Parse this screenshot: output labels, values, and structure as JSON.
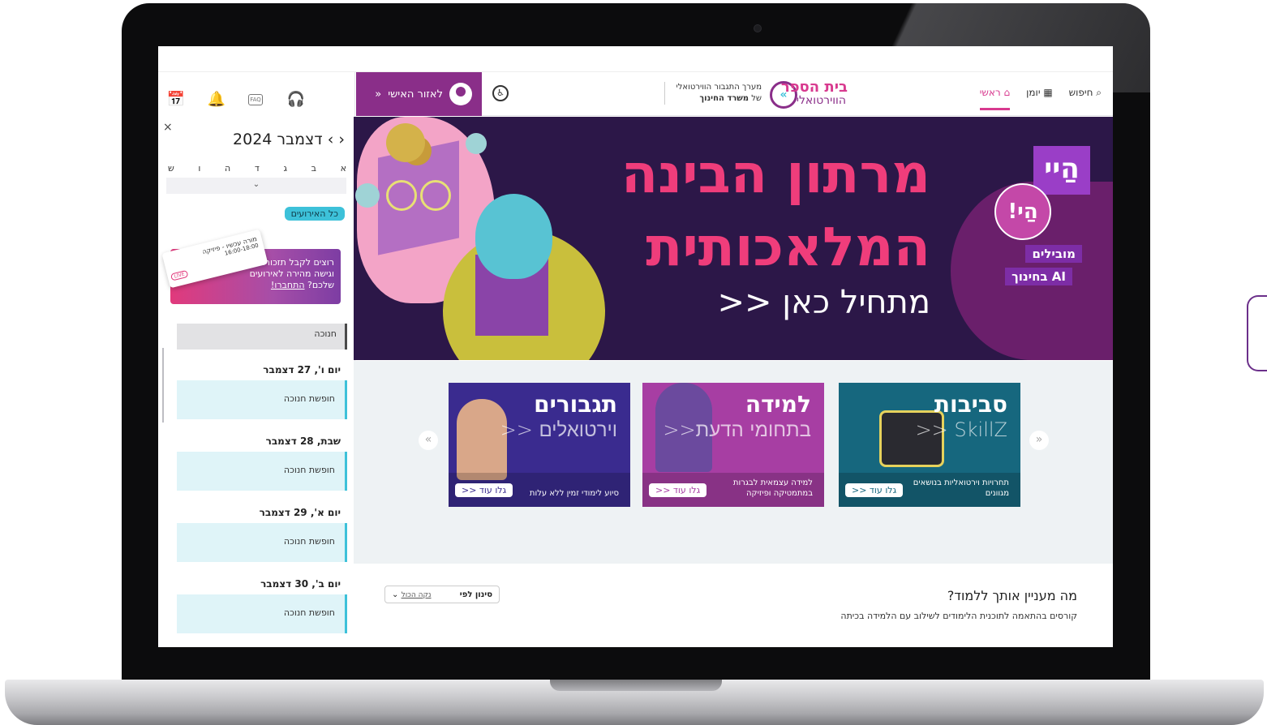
{
  "sidebar": {
    "icons": [
      "calendar-icon",
      "bell-icon",
      "faq-icon",
      "headset-icon"
    ],
    "faq_label": "FAQ",
    "close_label": "×",
    "month_title": "דצמבר 2024",
    "prev_label": "‹",
    "next_label": "›",
    "weekdays": [
      "א",
      "ב",
      "ג",
      "ד",
      "ה",
      "ו",
      "ש"
    ],
    "expand_label": "⌄",
    "all_events_label": "כל האירועים",
    "promo": {
      "text": "רוצים לקבל תזכורות וגישה מהירה לאירועים שלכם?",
      "link": "התחברו!",
      "card_title": "מורה עכשיו - פיזיקה",
      "card_time": "16:00-18:00",
      "card_live": "LIVE"
    },
    "events": [
      {
        "day": "",
        "title": "חנוכה"
      },
      {
        "day": "יום ו', 27 דצמבר",
        "title": "חופשת חנוכה"
      },
      {
        "day": "שבת, 28 דצמבר",
        "title": "חופשת חנוכה"
      },
      {
        "day": "יום א', 29 דצמבר",
        "title": "חופשת חנוכה"
      },
      {
        "day": "יום ב', 30 דצמבר",
        "title": "חופשת חנוכה"
      }
    ]
  },
  "header": {
    "profile_label": "לאזור האישי",
    "profile_arrow": "«",
    "org_line1": "מערך התגבור הווירטואלי",
    "org_line2_prefix": "של",
    "org_line2_bold": "משרד החינוך",
    "logo_title": "בית הספר",
    "logo_sub": "הווירטואלי",
    "nav": [
      {
        "label": "ראשי",
        "icon": "home-icon",
        "active": true
      },
      {
        "label": "יומן",
        "icon": "calendar-icon",
        "active": false
      },
      {
        "label": "חיפוש",
        "icon": "search-icon",
        "active": false
      }
    ]
  },
  "hero": {
    "title_line1": "מרתון הבינה",
    "title_line2": "המלאכותית",
    "cta": "מתחיל כאן <<",
    "badge_hey": "הַיי",
    "badge_hai": "הַי!",
    "tag1": "מובילים",
    "tag2": "AI בחינוך"
  },
  "cards": [
    {
      "title": "סביבות",
      "subtitle": "SkillZ <<",
      "desc": "תחרויות וירטואליות בנושאים מגוונים",
      "more": "גלו עוד <<"
    },
    {
      "title": "למידה",
      "subtitle": "בתחומי הדעת<<",
      "desc": "למידה עצמאית לבגרות במתמטיקה ופיזיקה",
      "more": "גלו עוד <<"
    },
    {
      "title": "תגבורים",
      "subtitle": "וירטואלים <<",
      "desc": "סיוע לימודי זמין ללא עלות",
      "more": "גלו עוד <<"
    }
  ],
  "carousel": {
    "prev": "«",
    "next": "»"
  },
  "courses": {
    "title": "מה מעניין אותך ללמוד?",
    "subtitle": "קורסים בהתאמה לתוכנית הלימודים לשילוב עם הלמידה בכיתה",
    "filter_label": "סינון לפי",
    "clear_label": "נקה הכול",
    "filter_caret": "⌄"
  },
  "colors": {
    "accent_pink": "#d83a8f",
    "profile_purple": "#8a2e89",
    "cyan": "#3dc1d9"
  }
}
